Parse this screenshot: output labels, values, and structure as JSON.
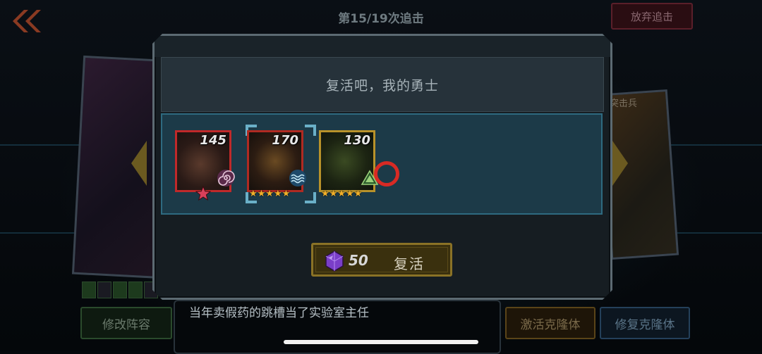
{
  "header": {
    "round_title": "第15/19次追击",
    "give_up_label": "放弃追击"
  },
  "background": {
    "right_card_label": "突击兵"
  },
  "dialog": {
    "title": "复活吧，我的勇士",
    "heroes": [
      {
        "power": "145",
        "stars": 1,
        "border_color": "#c0292a",
        "element_icon": "spiral-icon",
        "star_icon": "star-icon"
      },
      {
        "power": "170",
        "stars": 5,
        "border_color": "#b02a22",
        "element_icon": "water-wave-icon",
        "selected": true
      },
      {
        "power": "130",
        "stars": 5,
        "border_color": "#b8922a",
        "element_icon": "leaf-triangle-icon"
      }
    ],
    "revive_cost": "50",
    "revive_label": "复活"
  },
  "bottom": {
    "lineup_label": "修改阵容",
    "story_text": "当年卖假药的跳槽当了实验室主任",
    "activate_label": "激活克隆体",
    "repair_label": "修复克隆体"
  },
  "colors": {
    "accent_gold": "#8a7226",
    "panel_teal": "#1c3a48",
    "gem_purple": "#7a3ec8"
  }
}
